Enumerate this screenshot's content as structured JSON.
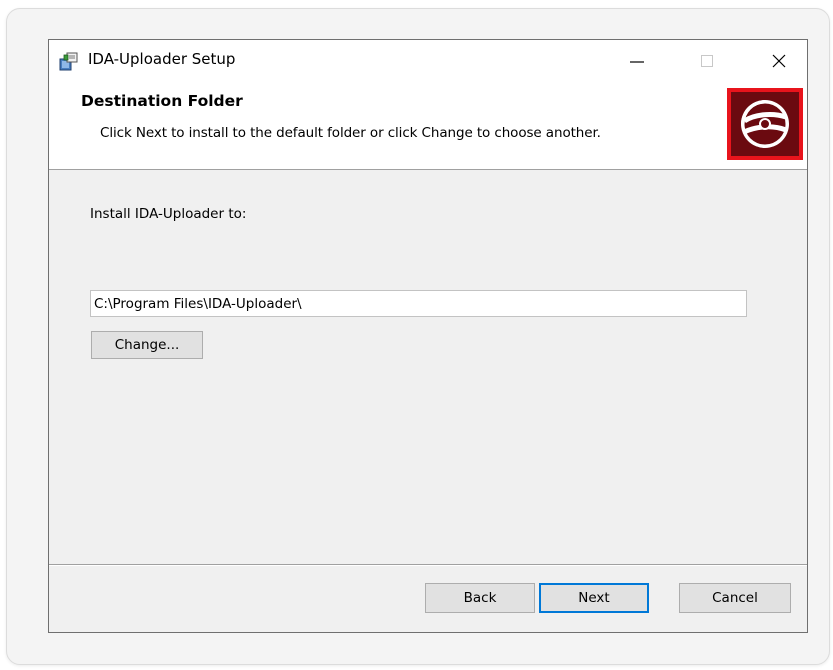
{
  "window": {
    "title": "IDA-Uploader Setup",
    "controls": {
      "minimize": "minimize",
      "maximize": "maximize",
      "close": "close"
    }
  },
  "header": {
    "title": "Destination Folder",
    "subtitle": "Click Next to install to the default folder or click Change to choose another."
  },
  "main": {
    "install_label": "Install IDA-Uploader to:",
    "path_value": "C:\\Program Files\\IDA-Uploader\\",
    "change_button": "Change..."
  },
  "footer": {
    "back_button": "Back",
    "next_button": "Next",
    "cancel_button": "Cancel"
  },
  "colors": {
    "accent_focus": "#0078d7",
    "logo_frame": "#e8141c",
    "logo_fill": "#6b0a10",
    "logo_disc": "#ffffff"
  },
  "icons": {
    "app": "installer-package-icon",
    "banner": "cd-disc-logo-icon"
  }
}
